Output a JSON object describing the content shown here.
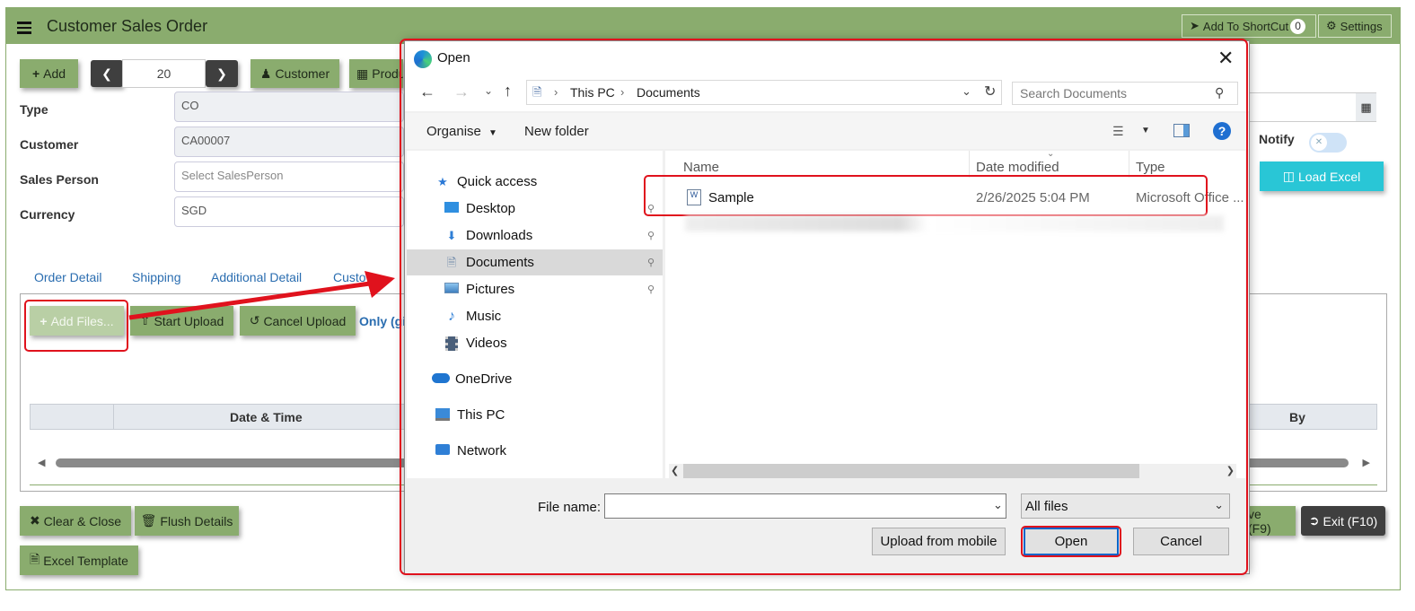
{
  "app": {
    "title": "Customer Sales Order",
    "add_shortcut_label": "Add To ShortCut",
    "shortcut_count": "0",
    "settings_label": "Settings"
  },
  "toolbar": {
    "add_label": "Add",
    "record_number": "20",
    "customer_label": "Customer",
    "product_label": "Produ"
  },
  "form": {
    "type_label": "Type",
    "type_value": "CO",
    "customer_label": "Customer",
    "customer_value": "CA00007",
    "salesperson_label": "Sales Person",
    "salesperson_placeholder": "Select SalesPerson",
    "currency_label": "Currency",
    "currency_value": "SGD",
    "notify_label": "Notify",
    "load_excel_label": "Load Excel"
  },
  "tabs": [
    "Order Detail",
    "Shipping",
    "Additional Detail",
    "Custo"
  ],
  "upload": {
    "add_files_label": "Add Files...",
    "start_upload_label": "Start Upload",
    "cancel_upload_label": "Cancel Upload",
    "note": "Only (gi"
  },
  "grid": {
    "columns": [
      "Date & Time",
      "By"
    ]
  },
  "footer": {
    "clear_close_label": "Clear & Close",
    "flush_label": "Flush Details",
    "excel_template_label": "Excel Template",
    "save_label": "ve (F9)",
    "exit_label": "Exit (F10)"
  },
  "dialog": {
    "title": "Open",
    "breadcrumb": [
      "This PC",
      "Documents"
    ],
    "search_placeholder": "Search Documents",
    "organise_label": "Organise",
    "new_folder_label": "New folder",
    "nav_items": [
      {
        "label": "Quick access",
        "icon": "star-icon"
      },
      {
        "label": "Desktop",
        "icon": "desktop-icon"
      },
      {
        "label": "Downloads",
        "icon": "download-icon"
      },
      {
        "label": "Documents",
        "icon": "document-icon"
      },
      {
        "label": "Pictures",
        "icon": "picture-icon"
      },
      {
        "label": "Music",
        "icon": "music-icon"
      },
      {
        "label": "Videos",
        "icon": "video-icon"
      },
      {
        "label": "OneDrive",
        "icon": "cloud-icon"
      },
      {
        "label": "This PC",
        "icon": "computer-icon"
      },
      {
        "label": "Network",
        "icon": "network-icon"
      }
    ],
    "columns": [
      "Name",
      "Date modified",
      "Type"
    ],
    "files": [
      {
        "name": "Sample",
        "modified": "2/26/2025 5:04 PM",
        "type": "Microsoft Office ..."
      }
    ],
    "filename_label": "File name:",
    "filename_value": "",
    "filter_value": "All files",
    "upload_mobile_label": "Upload from mobile",
    "open_label": "Open",
    "cancel_label": "Cancel"
  },
  "colors": {
    "header_green": "#8aac6e",
    "accent_teal": "#29c6d6",
    "highlight_red": "#e0121d",
    "link_blue": "#2a6db0"
  }
}
